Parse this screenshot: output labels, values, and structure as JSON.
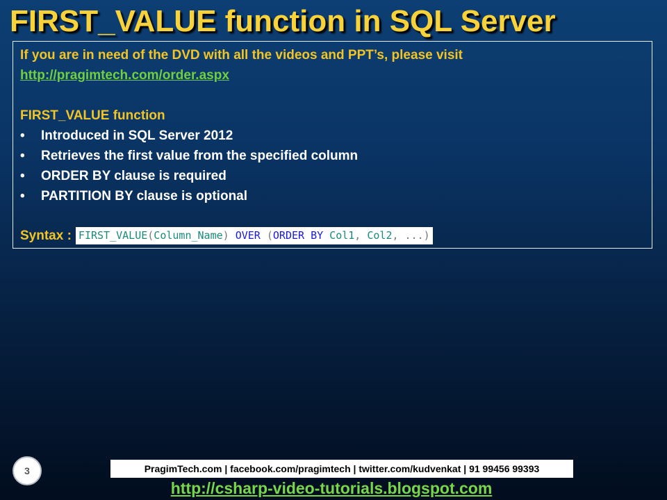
{
  "slide": {
    "title": "FIRST_VALUE function in SQL Server",
    "intro": "If you are in need of the DVD with all the videos and PPT’s, please visit",
    "order_link": "http://pragimtech.com/order.aspx",
    "section_heading": "FIRST_VALUE function",
    "bullets": [
      "Introduced in SQL Server 2012",
      "Retrieves the first value from the specified column",
      "ORDER BY clause is required",
      "PARTITION BY clause is optional"
    ],
    "syntax_label": "Syntax :",
    "syntax_code": {
      "fn": "FIRST_VALUE",
      "open": "(",
      "arg": "Column_Name",
      "close": ")",
      "over": "OVER",
      "open2": "(",
      "order_by": "ORDER BY",
      "col1": "Col1",
      "comma1": ",",
      "col2": "Col2",
      "comma2": ",",
      "ellipsis": "...",
      "close2": ")"
    },
    "bullet_glyph": "•"
  },
  "footer": {
    "page_number": "3",
    "contact": "PragimTech.com | facebook.com/pragimtech  | twitter.com/kudvenkat  | 91 99456 99393",
    "blog_link": "http://csharp-video-tutorials.blogspot.com"
  }
}
